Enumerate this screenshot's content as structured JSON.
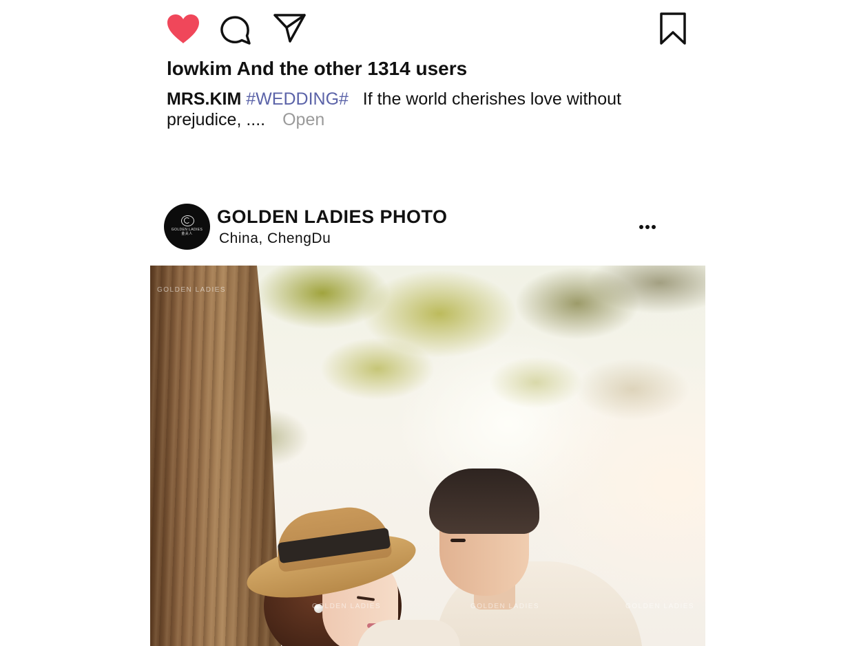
{
  "actions": {
    "like_icon": "heart-icon",
    "like_color": "#f0475a",
    "comment_icon": "comment-icon",
    "share_icon": "send-icon",
    "save_icon": "bookmark-icon"
  },
  "likes": {
    "text": "lowkim And the other 1314 users"
  },
  "caption": {
    "user": "MRS.KIM",
    "hashtag": "#WEDDING#",
    "hashtag_color": "#5b63a8",
    "text": "If the world cherishes love without prejudice, ....",
    "more_label": "Open"
  },
  "post": {
    "account_name": "GOLDEN LADIES PHOTO",
    "location": "China,  ChengDu",
    "avatar_logo_text": "GOLDEN LADIES",
    "avatar_logo_subtext": "金夫人",
    "menu_icon": "more-horizontal-icon",
    "photo_watermark": "GOLDEN LADIES"
  }
}
